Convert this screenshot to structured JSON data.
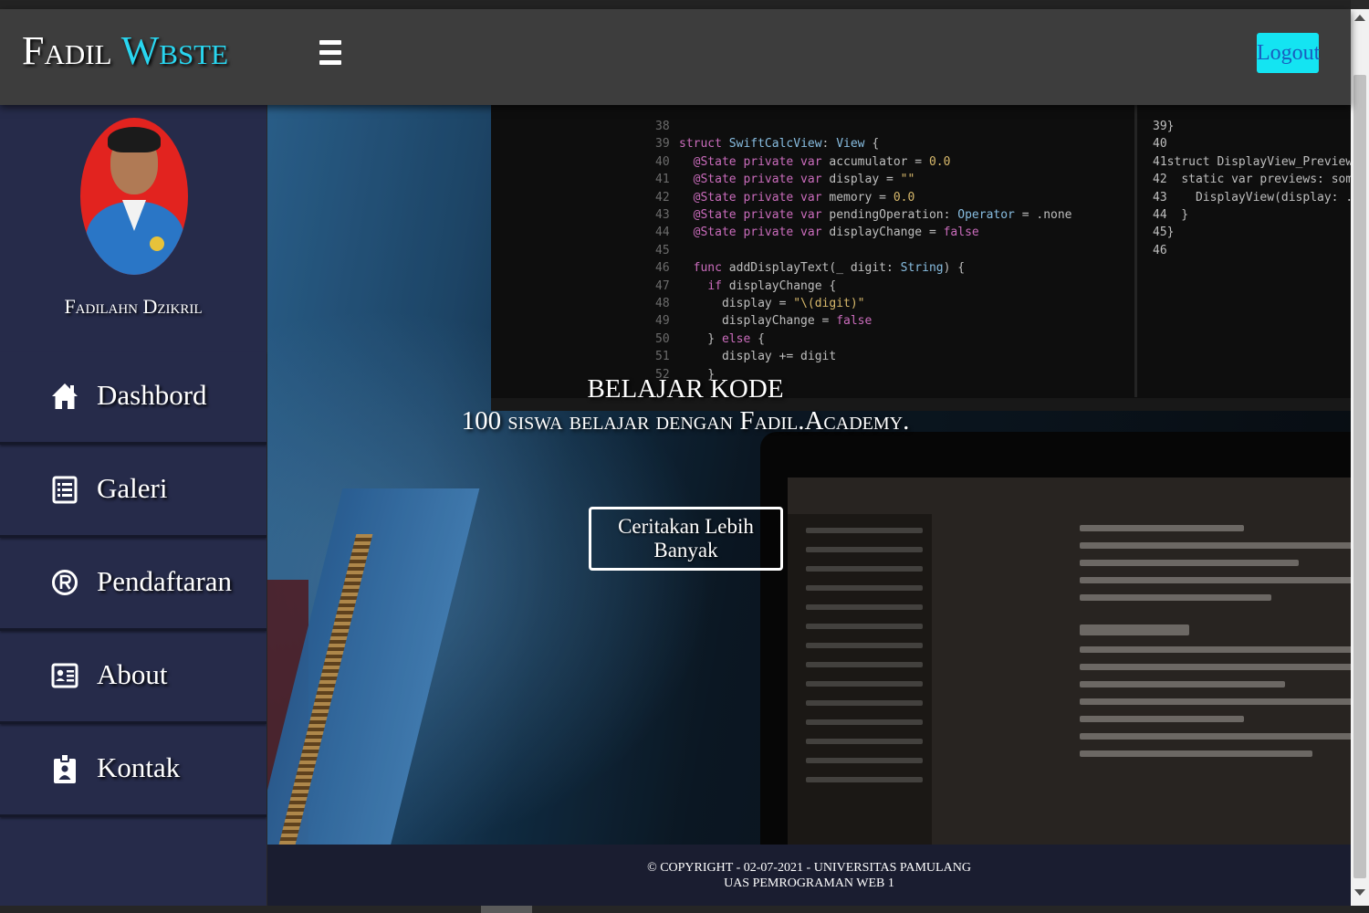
{
  "header": {
    "brand_part1": "Fadil",
    "brand_part2": "Wbste",
    "logout_label": "Logout"
  },
  "sidebar": {
    "profile_name": "Fadilahn Dzikril",
    "items": [
      {
        "label": "Dashbord",
        "icon": "home-icon"
      },
      {
        "label": "Galeri",
        "icon": "list-icon"
      },
      {
        "label": "Pendaftaran",
        "icon": "registered-icon"
      },
      {
        "label": "About",
        "icon": "id-card-icon"
      },
      {
        "label": "Kontak",
        "icon": "contact-badge-icon"
      }
    ]
  },
  "hero": {
    "title": "BELAJAR KODE",
    "subtitle": "100 siswa belajar dengan Fadil.Academy.",
    "button_label": "Ceritakan Lebih Banyak"
  },
  "footer": {
    "line1": "© COPYRIGHT - 02-07-2021 - UNIVERSITAS PAMULANG",
    "line2": "UAS PEMROGRAMAN WEB 1"
  },
  "colors": {
    "header_bg": "#3d3d3d",
    "sidebar_bg": "#262b4a",
    "accent_cyan": "#14e4f2",
    "brand_accent": "#29d6f0",
    "footer_bg": "#1a1d30"
  }
}
